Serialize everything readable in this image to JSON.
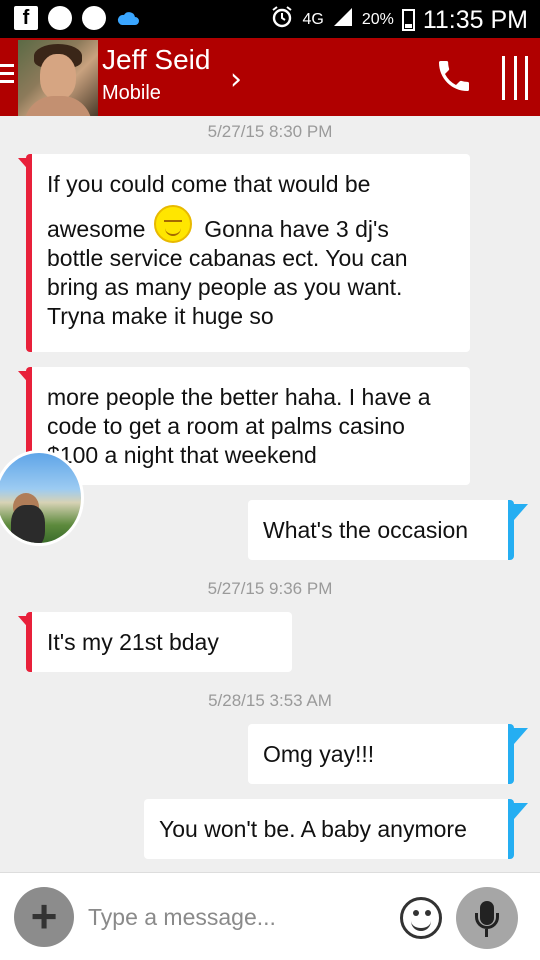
{
  "status_bar": {
    "icons": [
      "facebook-icon",
      "messenger-icon",
      "messenger-icon",
      "cloud-music-icon",
      "alarm-icon",
      "lte-icon",
      "signal-icon",
      "battery-icon"
    ],
    "network": "4G",
    "battery": "20%",
    "time": "11:35 PM"
  },
  "header": {
    "contact_name": "Jeff Seid",
    "contact_sub": "Mobile",
    "accent": "#b00000"
  },
  "conversation": {
    "ts1": "5/27/15 8:30 PM",
    "msg1_line1": "If you could come that would be",
    "msg1_awesome": "awesome",
    "msg1_after_smiley": "Gonna have 3 dj's",
    "msg1_rest": "bottle service cabanas ect. You can bring as many people as you want. Tryna make it huge so",
    "msg2": "more people the better haha. I have a code to get a room at palms casino $100 a night that weekend",
    "msg3": "What's the occasion",
    "ts2": "5/27/15 9:36 PM",
    "msg4": "It's my 21st bday",
    "ts3": "5/28/15 3:53 AM",
    "msg5": "Omg yay!!!",
    "msg6": "You won't be. A baby anymore",
    "incoming_color": "#e8203a",
    "outgoing_color": "#25aef2"
  },
  "composer": {
    "placeholder": "Type a message..."
  }
}
